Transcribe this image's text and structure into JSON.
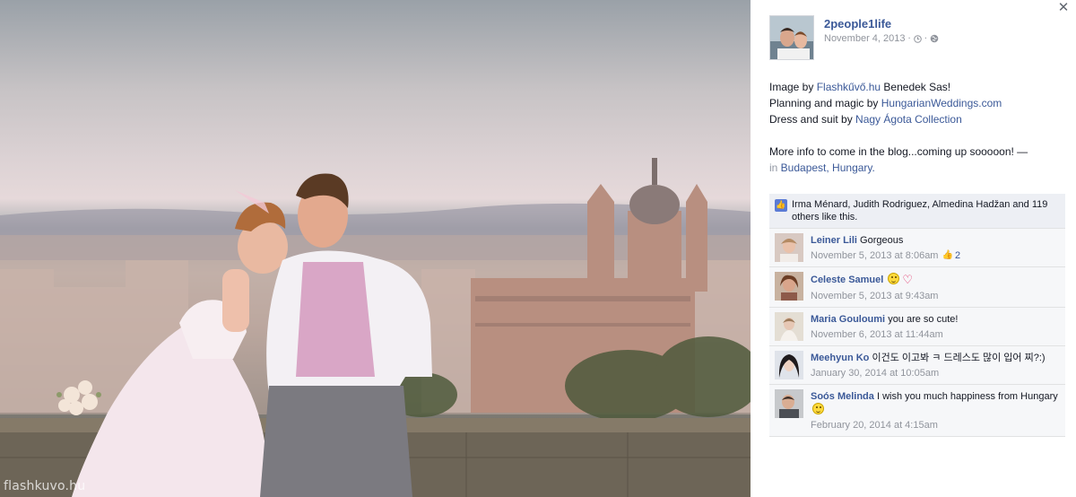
{
  "photo": {
    "watermark": "flashkuvo.hu"
  },
  "post": {
    "page_name": "2people1life",
    "date": "November 4, 2013",
    "clock_icon": "clock-icon",
    "globe_icon": "globe-icon",
    "close_glyph": "✕"
  },
  "caption": {
    "line1_prefix": "Image by ",
    "line1_link": "Flashkűvő.hu",
    "line1_suffix": " Benedek Sas!",
    "line2_prefix": "Planning and magic by ",
    "line2_link": "HungarianWeddings.com",
    "line3_prefix": "Dress and suit by ",
    "line3_link": "Nagy Ágota Collection",
    "line4": "More info to come in the blog...coming up sooooon! —",
    "line5_in": "in",
    "line5_place": " Budapest, Hungary."
  },
  "likes": {
    "text": "Irma Ménard, Judith Rodriguez, Almedina Hadžan and 119 others like this."
  },
  "comments": [
    {
      "name": "Leiner Lili",
      "text": "Gorgeous",
      "time": "November 5, 2013 at 8:06am",
      "likes": "2"
    },
    {
      "name": "Celeste Samuel",
      "text": "",
      "time": "November 5, 2013 at 9:43am"
    },
    {
      "name": "Maria Gouloumi",
      "text": "you are so cute!",
      "time": "November 6, 2013 at 11:44am"
    },
    {
      "name": "Meehyun Ko",
      "text": "이건도 이고봐 ㅋ 드레스도 많이 입어 찌?:)",
      "time": "January 30, 2014 at 10:05am"
    },
    {
      "name": "Soós Melinda",
      "text": "I wish you much happiness from Hungary",
      "time": "February 20, 2014 at 4:15am"
    }
  ],
  "colors": {
    "link": "#3b5998",
    "meta": "#90949c",
    "comment_bg": "#f6f7f9"
  }
}
